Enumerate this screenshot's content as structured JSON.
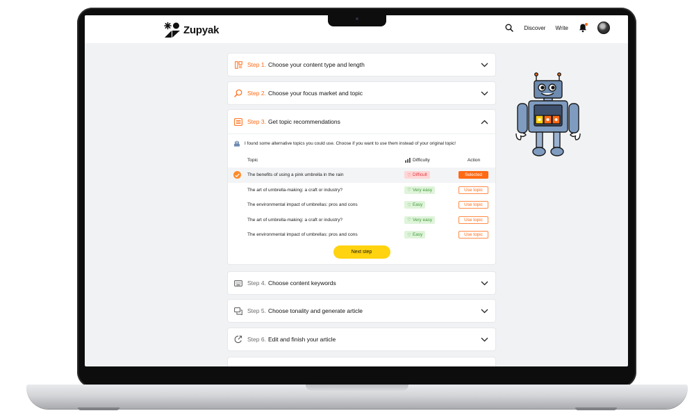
{
  "brand": {
    "name": "Zupyak"
  },
  "nav": {
    "discover": "Discover",
    "write": "Write"
  },
  "colors": {
    "accent": "#ff6a13",
    "cta": "#ffd30f",
    "difficult": "#e0383f",
    "easy": "#3d9b36"
  },
  "steps": [
    {
      "no": "Step 1.",
      "title": "Choose your content type and length",
      "icon": "content-type-icon",
      "state": "done"
    },
    {
      "no": "Step 2.",
      "title": "Choose your focus market and topic",
      "icon": "search-icon",
      "state": "done"
    },
    {
      "no": "Step 3.",
      "title": "Get topic recommendations",
      "icon": "list-icon",
      "state": "open"
    },
    {
      "no": "Step 4.",
      "title": "Choose content keywords",
      "icon": "keyboard-icon",
      "state": "pending"
    },
    {
      "no": "Step 5.",
      "title": "Choose tonality and generate article",
      "icon": "chat-icon",
      "state": "pending"
    },
    {
      "no": "Step 6.",
      "title": "Edit and finish your article",
      "icon": "edit-icon",
      "state": "pending"
    }
  ],
  "recommendations": {
    "message": "I found some alternative topics you could use. Choose if you want to use them instead of your original topic!",
    "headers": {
      "topic": "Topic",
      "difficulty": "Difficulty",
      "action": "Action"
    },
    "rows": [
      {
        "topic": "The benefits of using a pink umbrella in the rain",
        "difficulty": "Difficult",
        "level": "hard",
        "action": "Selected",
        "selected": true
      },
      {
        "topic": "The art of umbrella-making: a craft or industry?",
        "difficulty": "Very easy",
        "level": "easy",
        "action": "Use topic",
        "selected": false
      },
      {
        "topic": "The environmental impact of umbrellas: pros and cons",
        "difficulty": "Easy",
        "level": "easy",
        "action": "Use topic",
        "selected": false
      },
      {
        "topic": "The art of umbrella-making: a craft or industry?",
        "difficulty": "Very easy",
        "level": "easy",
        "action": "Use topic",
        "selected": false
      },
      {
        "topic": "The environmental impact of umbrellas: pros and cons",
        "difficulty": "Easy",
        "level": "easy",
        "action": "Use topic",
        "selected": false
      }
    ],
    "next_label": "Next step"
  }
}
